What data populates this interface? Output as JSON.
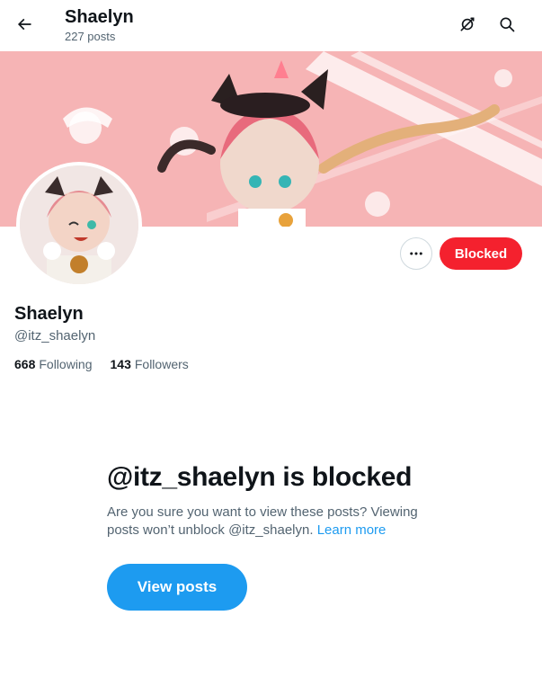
{
  "header": {
    "title": "Shaelyn",
    "post_count": "227 posts",
    "back_icon": "arrow-left-icon",
    "icons": [
      "cosmos-icon",
      "search-icon"
    ]
  },
  "profile": {
    "name": "Shaelyn",
    "handle": "@itz_shaelyn",
    "following_count": "668",
    "following_label": "Following",
    "followers_count": "143",
    "followers_label": "Followers"
  },
  "actions": {
    "more_icon": "more-icon",
    "blocked_label": "Blocked"
  },
  "blocked_notice": {
    "title": "@itz_shaelyn is blocked",
    "description": "Are you sure you want to view these posts? Viewing posts won’t unblock @itz_shaelyn.",
    "learn_more": "Learn more",
    "view_button": "View posts"
  },
  "colors": {
    "accent": "#1d9bf0",
    "danger": "#f4212e",
    "banner": "#f7b5b6",
    "secondary_text": "#536471"
  }
}
